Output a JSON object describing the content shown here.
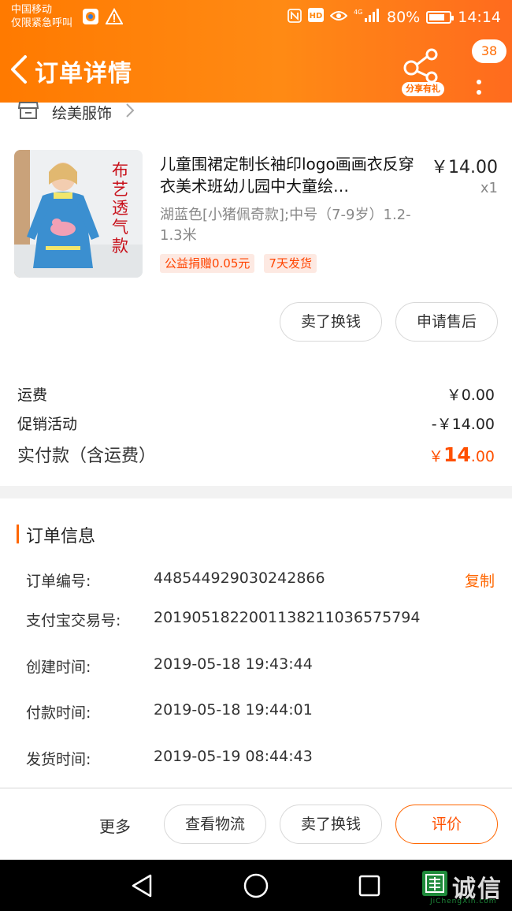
{
  "status_bar": {
    "carrier_line1": "中国移动",
    "carrier_line2": "仅限紧急呼叫",
    "network": "4G",
    "battery": "80%",
    "battery_level": 0.8,
    "time": "14:14"
  },
  "header": {
    "title": "订单详情",
    "share_label": "分享有礼",
    "badge_count": "38",
    "accent_color": "#ff7a00"
  },
  "store": {
    "name": "绘美服饰"
  },
  "product": {
    "image_caption": "布艺透气款",
    "title": "儿童围裙定制长袖印logo画画衣反穿衣美术班幼儿园中大童绘…",
    "price": "￥14.00",
    "quantity": "x1",
    "spec": "湖蓝色[小猪佩奇款];中号（7-9岁）1.2-1.3米",
    "tags": [
      "公益捐赠0.05元",
      "7天发货"
    ]
  },
  "item_actions": {
    "resell": "卖了换钱",
    "after_sale": "申请售后"
  },
  "fees": {
    "shipping_label": "运费",
    "shipping_value": "￥0.00",
    "promo_label": "促销活动",
    "promo_value": "-￥14.00",
    "total_label": "实付款（含运费）",
    "total_currency": "￥",
    "total_int": "14",
    "total_dec": ".00"
  },
  "order_info": {
    "title": "订单信息",
    "copy_label": "复制",
    "rows": [
      {
        "label": "订单编号:",
        "value": "448544929030242866"
      },
      {
        "label": "支付宝交易号:",
        "value": "2019051822001138211036575794"
      },
      {
        "label": "创建时间:",
        "value": "2019-05-18 19:43:44"
      },
      {
        "label": "付款时间:",
        "value": "2019-05-18 19:44:01"
      },
      {
        "label": "发货时间:",
        "value": "2019-05-19 08:44:43"
      }
    ]
  },
  "bottom_actions": {
    "more": "更多",
    "logistics": "查看物流",
    "resell": "卖了换钱",
    "review": "评价"
  },
  "watermark": {
    "text": "诚信",
    "sub": "JiChengXin.com"
  }
}
